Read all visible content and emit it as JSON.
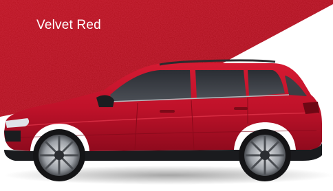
{
  "colour_name": "Velvet Red",
  "colors": {
    "swatch_red": "#b3121f",
    "car_body_red": "#c4122a",
    "background": "#ffffff"
  },
  "images": {
    "texture": "metallic-red-paint-texture",
    "vehicle": "red-suv-side-view"
  }
}
